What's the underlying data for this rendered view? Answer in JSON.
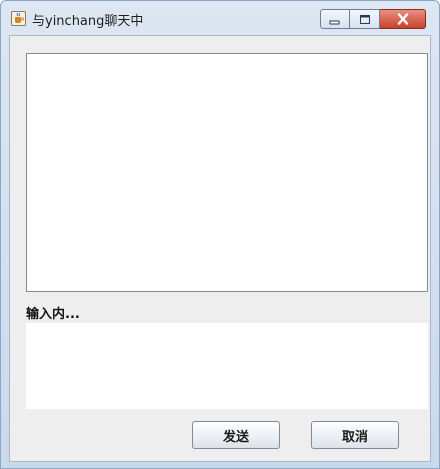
{
  "window": {
    "title": "与yinchang聊天中",
    "controls": {
      "minimize": "minimize-icon",
      "maximize": "maximize-icon",
      "close": "close-icon"
    },
    "app_icon": "java-cup-icon"
  },
  "chat": {
    "history_text": "",
    "input_label": "输入内...",
    "input_value": ""
  },
  "buttons": {
    "send_label": "发送",
    "cancel_label": "取消"
  },
  "colors": {
    "titlebar": "#d3e0f0",
    "close_button": "#c8412c",
    "client_bg": "#eeeeee"
  }
}
